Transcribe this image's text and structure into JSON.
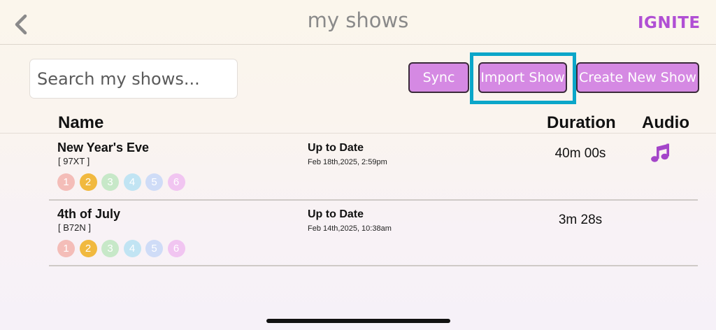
{
  "header": {
    "title": "my shows",
    "logo_text": "IGNITE",
    "back_icon": "chevron-left-icon"
  },
  "search": {
    "placeholder": "Search my shows...",
    "value": ""
  },
  "actions": {
    "sync_label": "Sync",
    "import_label": "Import Show",
    "create_label": "Create New Show",
    "highlighted": "Import Show"
  },
  "columns": {
    "name": "Name",
    "duration": "Duration",
    "audio": "Audio"
  },
  "shows": [
    {
      "name": "New Year's Eve",
      "code": "[ 97XT ]",
      "status": "Up to Date",
      "timestamp": "Feb 18th,2025, 2:59pm",
      "duration": "40m 00s",
      "has_audio": true,
      "dots": [
        "1",
        "2",
        "3",
        "4",
        "5",
        "6"
      ]
    },
    {
      "name": "4th of July",
      "code": "[ B72N ]",
      "status": "Up to Date",
      "timestamp": "Feb 14th,2025, 10:38am",
      "duration": "3m 28s",
      "has_audio": false,
      "dots": [
        "1",
        "2",
        "3",
        "4",
        "5",
        "6"
      ]
    }
  ],
  "colors": {
    "accent_button": "#d589e3",
    "highlight_box": "#0ba6c9",
    "logo": "#b04fd4",
    "audio_icon": "#a445c9",
    "dot_colors": [
      "#f4bdb8",
      "#f1b93f",
      "#c7e8c8",
      "#c1e4f3",
      "#cfdcf7",
      "#f1c5f1"
    ]
  }
}
